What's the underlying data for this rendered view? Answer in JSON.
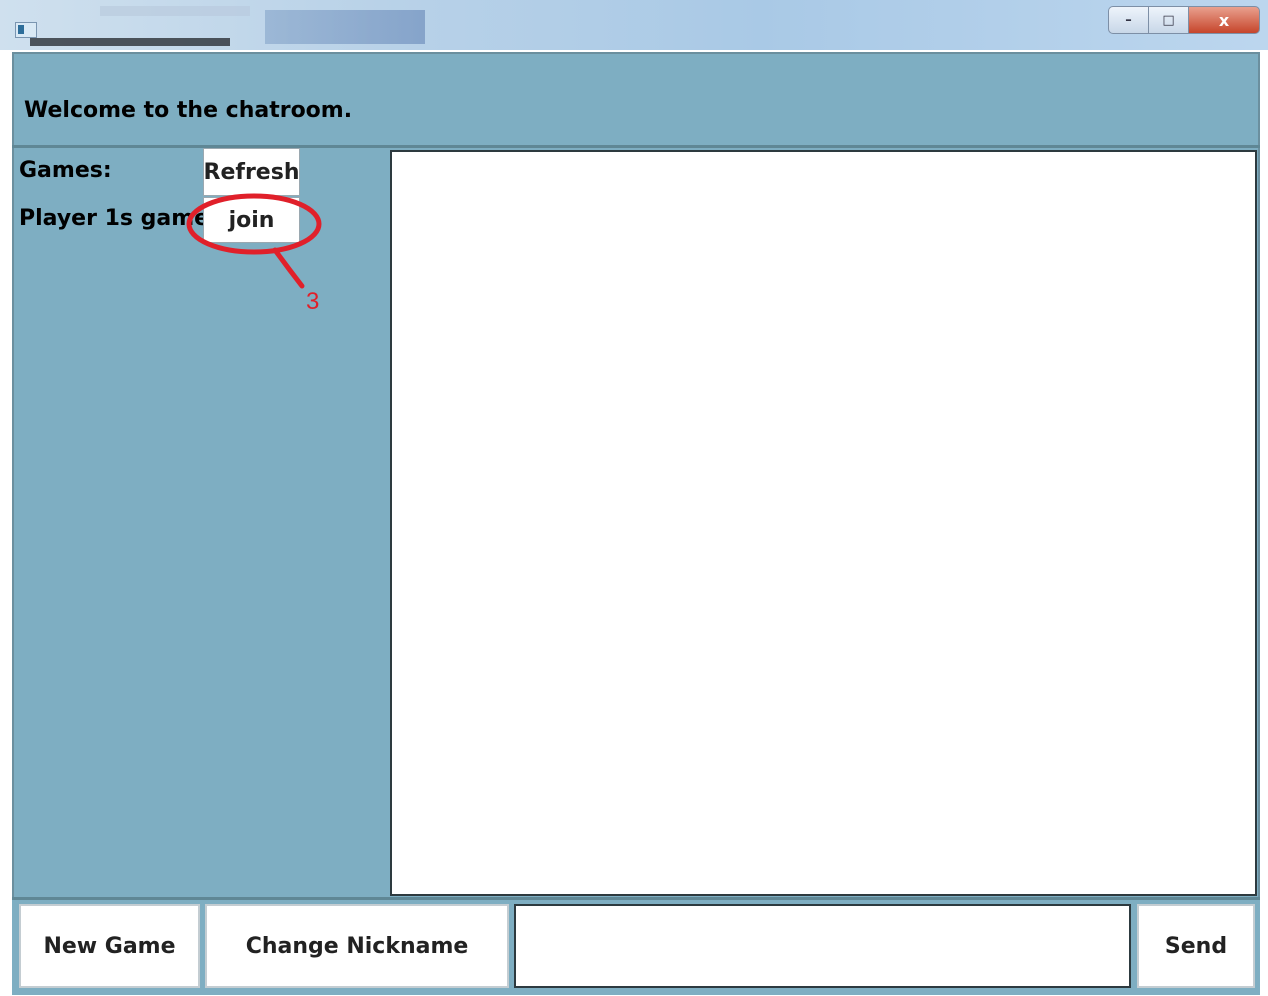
{
  "window": {
    "buttons": {
      "minimize": "–",
      "maximize": "□",
      "close": "x"
    }
  },
  "header": {
    "welcome_text": "Welcome to the chatroom."
  },
  "sidebar": {
    "games_label": "Games:",
    "refresh_label": "Refresh",
    "games": [
      {
        "name": "Player 1s game",
        "join_label": "join"
      }
    ]
  },
  "annotation": {
    "number": "3",
    "color": "#e0202a"
  },
  "chat": {
    "messages": []
  },
  "bottom": {
    "new_game_label": "New Game",
    "change_nickname_label": "Change Nickname",
    "message_value": "",
    "send_label": "Send"
  },
  "colors": {
    "panel": "#7eaec2",
    "annotation": "#e0202a"
  }
}
